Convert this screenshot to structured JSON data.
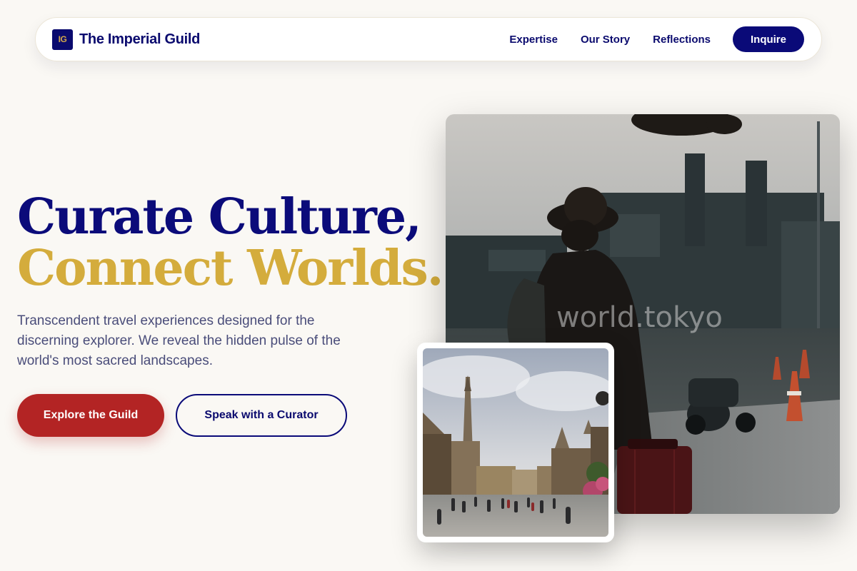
{
  "nav": {
    "logo_mark": "IG",
    "brand": "The Imperial Guild",
    "links": [
      "Expertise",
      "Our Story",
      "Reflections"
    ],
    "cta": "Inquire"
  },
  "hero": {
    "headline_line1": "Curate Culture,",
    "headline_line2": "Connect Worlds.",
    "lead": "Transcendent travel experiences designed for the discerning explorer. We reveal the hidden pulse of the world's most sacred landscapes.",
    "primary_cta": "Explore the Guild",
    "secondary_cta": "Speak with a Curator"
  },
  "images": {
    "main_watermark": "world.tokyo"
  },
  "colors": {
    "navy": "#0a0a78",
    "gold": "#d4ac3c",
    "crimson": "#b32424",
    "background": "#faf8f4"
  }
}
